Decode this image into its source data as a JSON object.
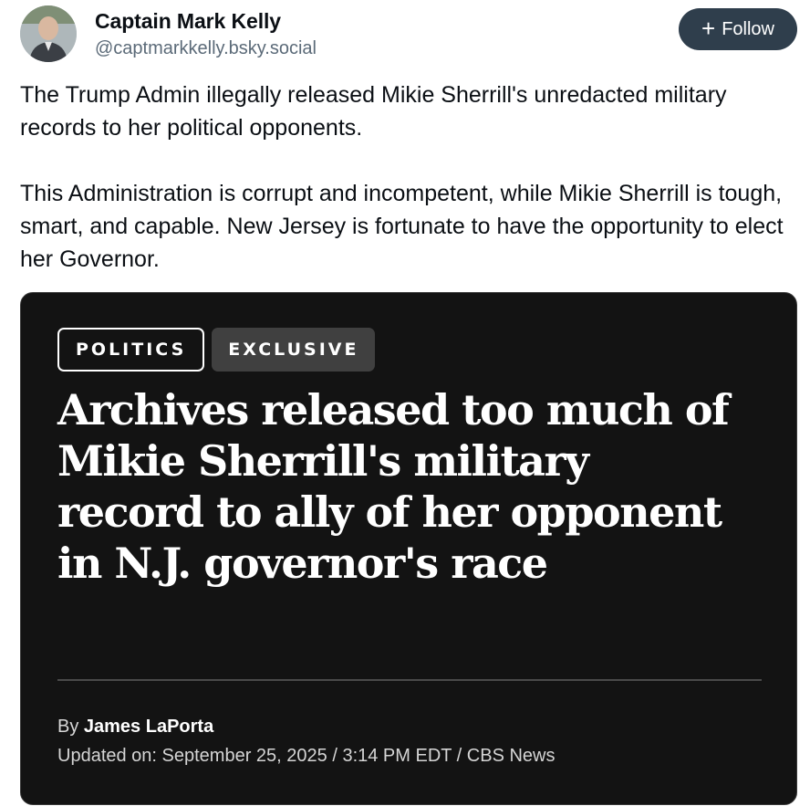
{
  "author": {
    "display_name": "Captain Mark Kelly",
    "handle": "@captmarkkelly.bsky.social"
  },
  "follow_button": {
    "icon": "plus-icon",
    "label": "Follow"
  },
  "post": {
    "paragraphs": [
      "The Trump Admin illegally released Mikie Sherrill's unredacted military records to her political opponents.",
      "This Administration is corrupt and incompetent, while Mikie Sherrill is tough, smart, and capable. New Jersey is fortunate to have the opportunity to elect her Governor."
    ]
  },
  "embed": {
    "tags": [
      "POLITICS",
      "EXCLUSIVE"
    ],
    "headline": "Archives released too much of Mikie Sherrill's military record to ally of her opponent in N.J. governor's race",
    "by_prefix": "By",
    "author": "James LaPorta",
    "updated": "Updated on: September 25, 2025 / 3:14 PM EDT / CBS News"
  },
  "colors": {
    "follow_bg": "#2f3e4c",
    "embed_bg": "#131313",
    "handle": "#5b6a78"
  }
}
